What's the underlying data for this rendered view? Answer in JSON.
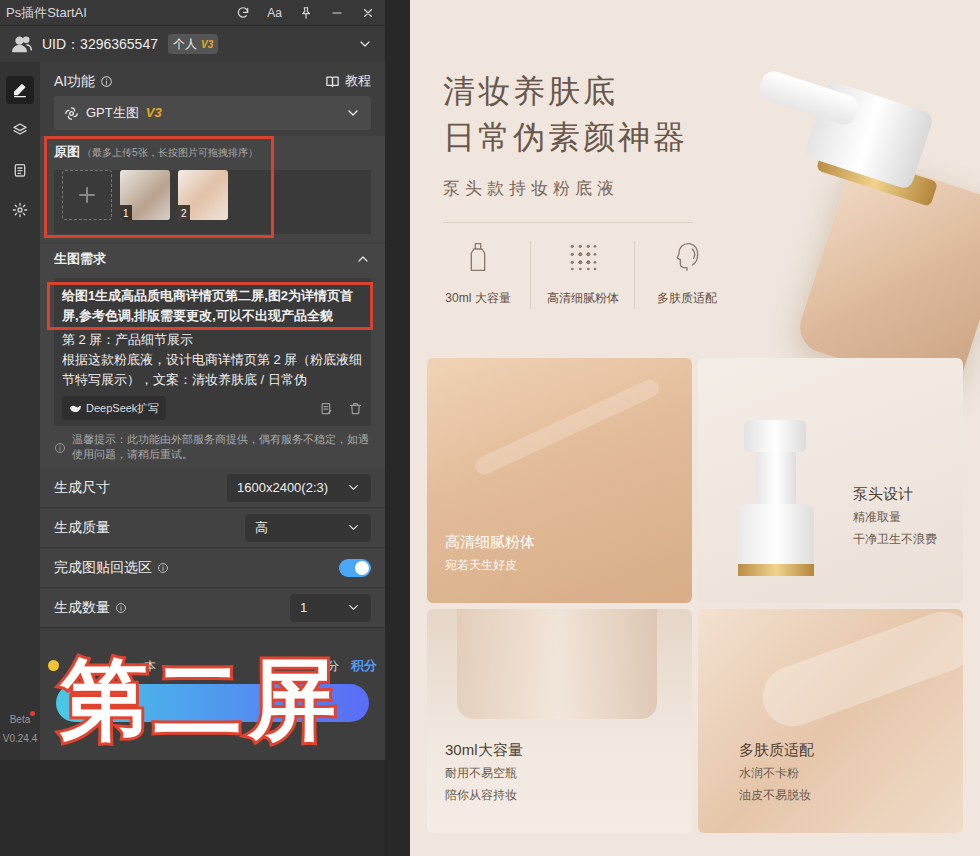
{
  "title_bar": {
    "title": "Ps插件StartAI",
    "font_button": "Aa"
  },
  "user": {
    "uid": "UID：3296365547",
    "badge": "个人",
    "badge_level": "V3"
  },
  "sidebar": {
    "items": [
      {
        "kind": "pencil",
        "selected": true
      },
      {
        "kind": "layers",
        "selected": false
      },
      {
        "kind": "clipboard",
        "selected": false
      },
      {
        "kind": "gear",
        "selected": false
      }
    ]
  },
  "version": {
    "label": "Beta",
    "dot": true,
    "number": "V0.24.4"
  },
  "ai_function": {
    "label": "AI功能",
    "info": true,
    "tutorial": "教程",
    "model": "GPT生图",
    "model_level": "V3"
  },
  "source_images": {
    "title": "原图",
    "hint": "（最多上传5张，长按图片可拖拽排序）",
    "images": [
      {
        "index": "1",
        "kind": "product"
      },
      {
        "index": "2",
        "kind": "model"
      }
    ]
  },
  "prompt": {
    "title": "生图需求",
    "expanded": true,
    "paragraphs": [
      "给图1生成高品质电商详情页第二屏,图2为详情页首屏,参考色调,排版需要更改,可以不出现产品全貌",
      "第 2 屏：产品细节展示",
      "根据这款粉底液，设计电商详情页第 2 屏（粉底液细节特写展示），文案：清妆养肤底 / 日常伪"
    ],
    "expand_button": "DeepSeek扩写"
  },
  "notice": "温馨提示：此功能由外部服务商提供，偶有服务不稳定，如遇使用问题，请稍后重试。",
  "settings": [
    {
      "kind": "select",
      "label": "生成尺寸",
      "info": false,
      "value": "1600x2400(2:3)"
    },
    {
      "kind": "select",
      "label": "生成质量",
      "info": false,
      "value": "高"
    },
    {
      "kind": "toggle",
      "label": "完成图贴回选区",
      "info": true,
      "on": true
    },
    {
      "kind": "select",
      "label": "生成数量",
      "info": true,
      "value": "1"
    }
  ],
  "footer": {
    "cost_prefix": "本",
    "cost_unit": "积分",
    "balance_unit": "积分"
  },
  "overlay": "第二屏",
  "poster": {
    "title_lines": [
      "清妆养肤底",
      "日常伪素颜神器"
    ],
    "subtitle": "泵头款持妆粉底液",
    "features": [
      {
        "kind": "bottle",
        "label": "30ml 大容量"
      },
      {
        "kind": "dots",
        "label": "高清细腻粉体"
      },
      {
        "kind": "face",
        "label": "多肤质适配"
      }
    ],
    "cards": [
      {
        "kind": "texture",
        "title": "高清细腻粉体",
        "lines": [
          "宛若天生好皮"
        ]
      },
      {
        "kind": "pump",
        "title": "泵头设计",
        "lines": [
          "精准取量",
          "干净卫生不浪费"
        ]
      },
      {
        "kind": "bottle",
        "title": "30ml大容量",
        "lines": [
          "耐用不易空瓶",
          "陪你从容持妆"
        ]
      },
      {
        "kind": "swirl",
        "title": "多肤质适配",
        "lines": [
          "水润不卡粉",
          "油皮不易脱妆"
        ]
      }
    ]
  }
}
